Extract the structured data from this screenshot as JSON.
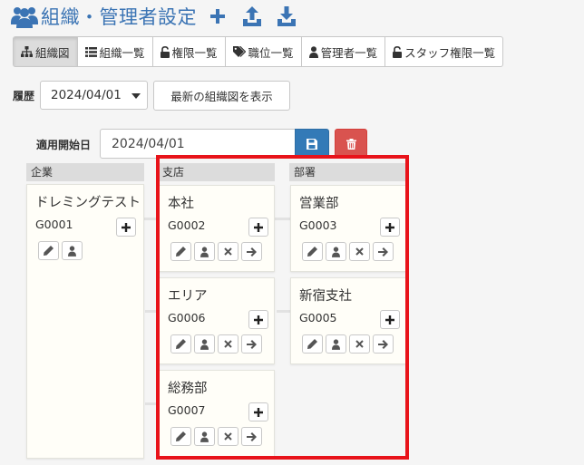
{
  "page": {
    "title": "組織・管理者設定"
  },
  "tabs": [
    {
      "label": "組織図",
      "icon": "sitemap-icon",
      "active": true
    },
    {
      "label": "組織一覧",
      "icon": "list-icon",
      "active": false
    },
    {
      "label": "権限一覧",
      "icon": "unlock-icon",
      "active": false
    },
    {
      "label": "職位一覧",
      "icon": "tags-icon",
      "active": false
    },
    {
      "label": "管理者一覧",
      "icon": "user-icon",
      "active": false
    },
    {
      "label": "スタッフ権限一覧",
      "icon": "unlock-icon",
      "active": false
    }
  ],
  "history": {
    "label": "履歴",
    "selected": "2024/04/01",
    "latest_button": "最新の組織図を表示"
  },
  "start_date": {
    "label": "適用開始日",
    "value": "2024/04/01"
  },
  "columns": {
    "company": "企業",
    "branch": "支店",
    "department": "部署"
  },
  "company_cards": [
    {
      "name": "ドレミングテスト",
      "code": "G0001"
    }
  ],
  "branch_cards": [
    {
      "name": "本社",
      "code": "G0002"
    },
    {
      "name": "エリア",
      "code": "G0006"
    },
    {
      "name": "総務部",
      "code": "G0007"
    }
  ],
  "department_cards": [
    {
      "name": "営業部",
      "code": "G0003"
    },
    {
      "name": "新宿支社",
      "code": "G0005"
    }
  ],
  "colors": {
    "accent": "#3b74b4",
    "primary": "#337ab7",
    "danger": "#d9534f",
    "highlight": "#e8131a"
  }
}
